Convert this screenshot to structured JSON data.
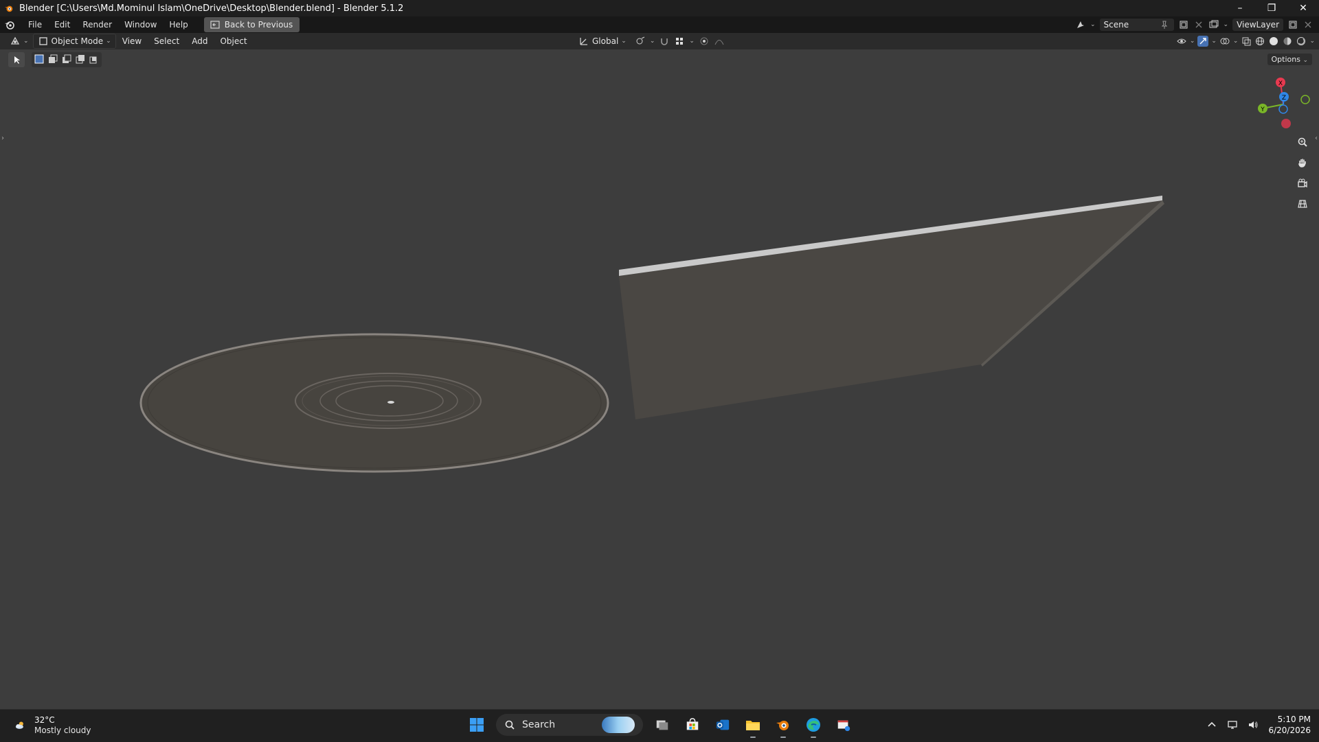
{
  "window": {
    "title": "Blender [C:\\Users\\Md.Mominul Islam\\OneDrive\\Desktop\\Blender.blend] - Blender 5.1.2",
    "controls": {
      "minimize": "–",
      "restore": "❐",
      "close": "✕"
    }
  },
  "menubar": {
    "items": [
      "File",
      "Edit",
      "Render",
      "Window",
      "Help"
    ],
    "back_button": "Back to Previous",
    "scene": "Scene",
    "view_layer": "ViewLayer"
  },
  "header3d": {
    "mode": "Object Mode",
    "menus": [
      "View",
      "Select",
      "Add",
      "Object"
    ],
    "transform_orientation": "Global",
    "options": "Options"
  },
  "gizmo": {
    "x": "X",
    "y": "Y",
    "z": "Z",
    "colors": {
      "x": "#e83a50",
      "y": "#7ab628",
      "z": "#2f87e8"
    }
  },
  "viewport": {
    "background": "#3d3d3d",
    "objects": [
      "vinyl-record",
      "record-sleeve"
    ]
  },
  "taskbar": {
    "weather": {
      "temp": "32°C",
      "condition": "Mostly cloudy"
    },
    "search_placeholder": "Search",
    "apps": [
      "windows-start-icon",
      "task-view-icon",
      "microsoft-store-icon",
      "outlook-icon",
      "file-explorer-icon",
      "blender-icon",
      "edge-icon",
      "snipping-tool-icon"
    ],
    "time": "5:10 PM",
    "date": "6/20/2026"
  }
}
